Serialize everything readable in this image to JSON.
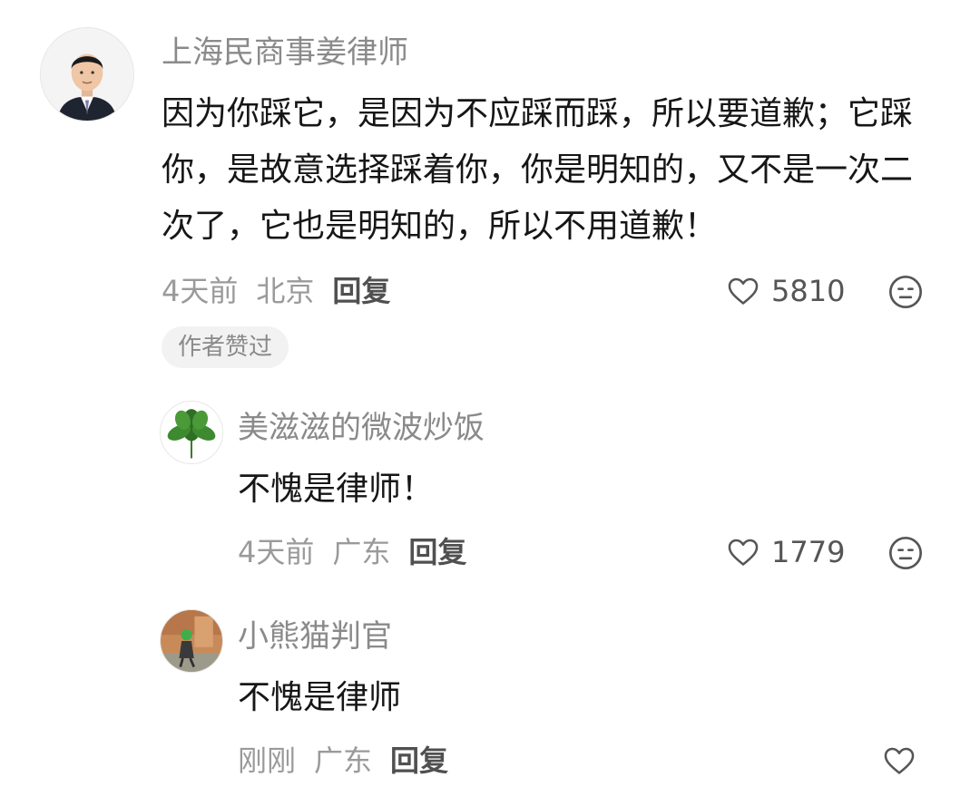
{
  "comments": [
    {
      "username": "上海民商事姜律师",
      "content": "因为你踩它，是因为不应踩而踩，所以要道歉；它踩你，是故意选择踩着你，你是明知的，又不是一次二次了，它也是明知的，所以不用道歉！",
      "time": "4天前",
      "location": "北京",
      "reply_label": "回复",
      "likes": "5810",
      "badge": "作者赞过",
      "avatar_icon": "lawyer-portrait",
      "react_icon": "meh-face-icon"
    },
    {
      "username": "美滋滋的微波炒饭",
      "content": "不愧是律师！",
      "time": "4天前",
      "location": "广东",
      "reply_label": "回复",
      "likes": "1779",
      "avatar_icon": "leafy-plant",
      "react_icon": "meh-face-icon"
    },
    {
      "username": "小熊猫判官",
      "content": "不愧是律师",
      "time": "刚刚",
      "location": "广东",
      "reply_label": "回复",
      "avatar_icon": "person-photo"
    }
  ],
  "colors": {
    "username": "#8a8a8a",
    "content": "#161616",
    "meta": "#9a9a9a",
    "badge_bg": "#f2f2f2"
  }
}
